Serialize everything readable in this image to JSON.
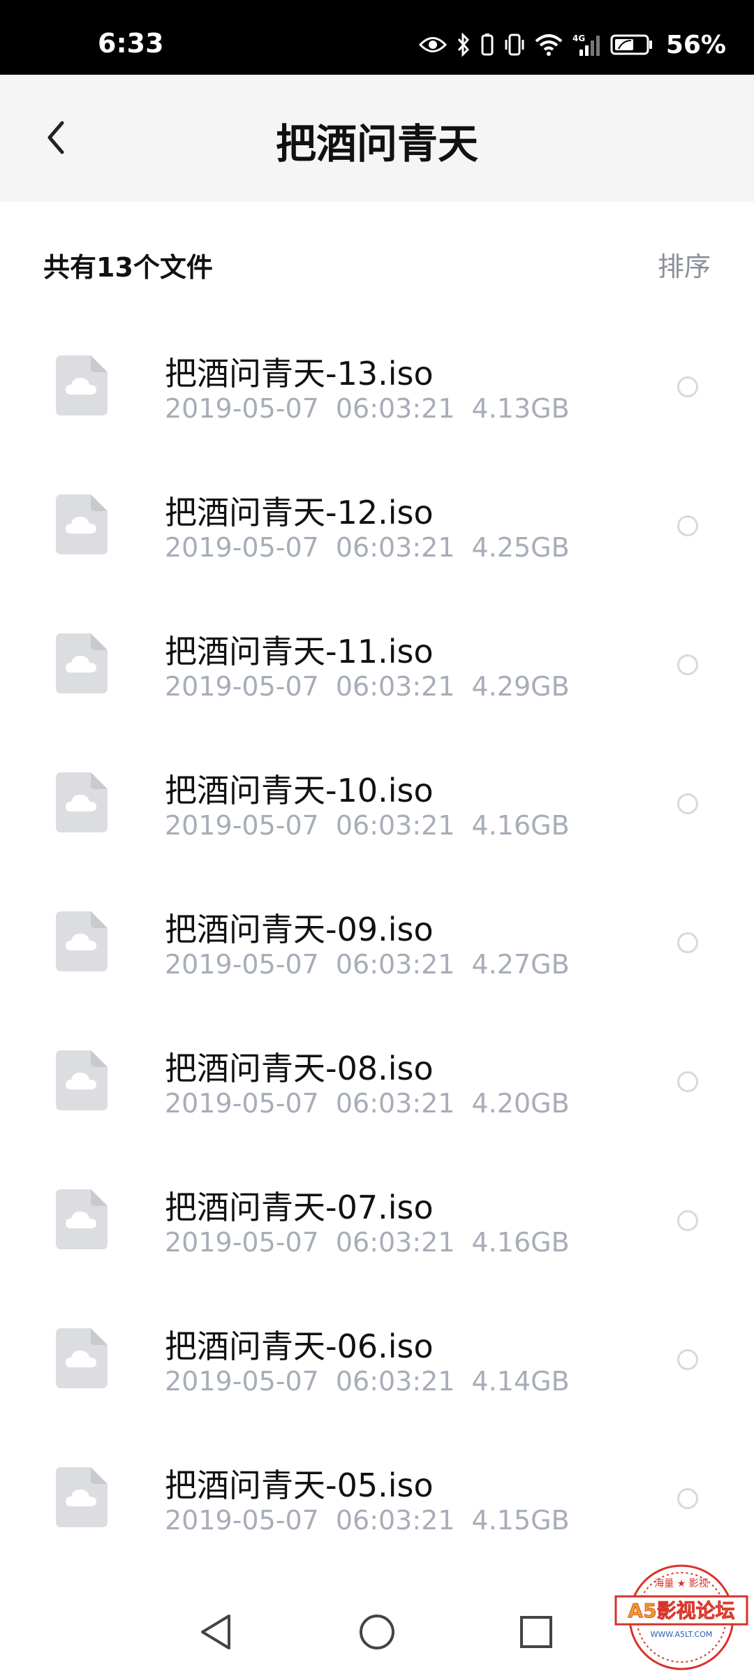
{
  "status_bar": {
    "time": "6:33",
    "battery": "56%",
    "network": "4G"
  },
  "header": {
    "title": "把酒问青天",
    "back_icon": "chevron-left-icon"
  },
  "summary": {
    "file_count": "共有13个文件",
    "sort_label": "排序"
  },
  "files": [
    {
      "name": "把酒问青天-13.iso",
      "date": "2019-05-07",
      "time": "06:03:21",
      "size": "4.13GB",
      "icon": "cloud-file-icon"
    },
    {
      "name": "把酒问青天-12.iso",
      "date": "2019-05-07",
      "time": "06:03:21",
      "size": "4.25GB",
      "icon": "cloud-file-icon"
    },
    {
      "name": "把酒问青天-11.iso",
      "date": "2019-05-07",
      "time": "06:03:21",
      "size": "4.29GB",
      "icon": "cloud-file-icon"
    },
    {
      "name": "把酒问青天-10.iso",
      "date": "2019-05-07",
      "time": "06:03:21",
      "size": "4.16GB",
      "icon": "cloud-file-icon"
    },
    {
      "name": "把酒问青天-09.iso",
      "date": "2019-05-07",
      "time": "06:03:21",
      "size": "4.27GB",
      "icon": "cloud-file-icon"
    },
    {
      "name": "把酒问青天-08.iso",
      "date": "2019-05-07",
      "time": "06:03:21",
      "size": "4.20GB",
      "icon": "cloud-file-icon"
    },
    {
      "name": "把酒问青天-07.iso",
      "date": "2019-05-07",
      "time": "06:03:21",
      "size": "4.16GB",
      "icon": "cloud-file-icon"
    },
    {
      "name": "把酒问青天-06.iso",
      "date": "2019-05-07",
      "time": "06:03:21",
      "size": "4.14GB",
      "icon": "cloud-file-icon"
    },
    {
      "name": "把酒问青天-05.iso",
      "date": "2019-05-07",
      "time": "06:03:21",
      "size": "4.15GB",
      "icon": "cloud-file-icon"
    }
  ],
  "nav_bar": {
    "back": "triangle-back-icon",
    "home": "circle-home-icon",
    "recents": "square-recents-icon"
  },
  "watermark": {
    "text": "A5影视论坛",
    "top_text": "海量 ★ 影视",
    "url": "WWW.A5LT.COM"
  },
  "colors": {
    "status_bar_bg": "#000000",
    "header_bg": "#f5f5f5",
    "meta_text": "#a7adb8",
    "sort_text": "#8a8f99",
    "icon_fill": "#dcdde1"
  }
}
